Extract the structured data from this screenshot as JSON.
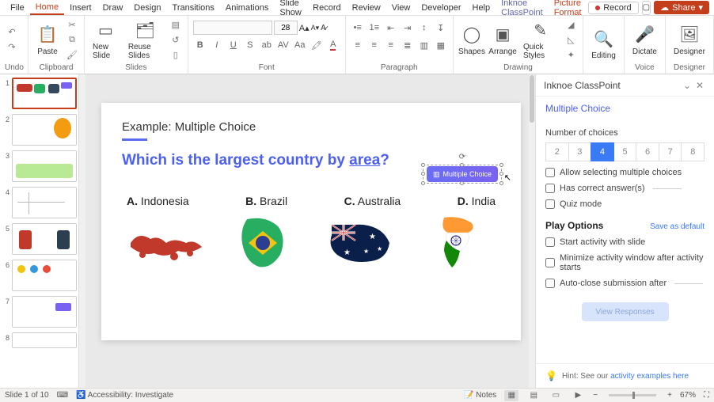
{
  "menubar": {
    "tabs": [
      "File",
      "Home",
      "Insert",
      "Draw",
      "Design",
      "Transitions",
      "Animations",
      "Slide Show",
      "Record",
      "Review",
      "View",
      "Developer",
      "Help"
    ],
    "addin": "Inknoe ClassPoint",
    "contextual": "Picture Format",
    "record": "Record",
    "share": "Share"
  },
  "ribbon": {
    "undo_label": "Undo",
    "paste": "Paste",
    "clipboard": "Clipboard",
    "new_slide": "New Slide",
    "reuse": "Reuse Slides",
    "slides": "Slides",
    "font_size": "28",
    "font": "",
    "font_group": "Font",
    "paragraph": "Paragraph",
    "shapes": "Shapes",
    "arrange": "Arrange",
    "quick": "Quick Styles",
    "drawing": "Drawing",
    "editing": "Editing",
    "dictate": "Dictate",
    "voice": "Voice",
    "designer": "Designer",
    "designer_group": "Designer"
  },
  "slide": {
    "label": "Example: Multiple Choice",
    "question_pre": "Which is the largest country by ",
    "question_u": "area",
    "question_post": "?",
    "opts": [
      {
        "letter": "A.",
        "text": "Indonesia"
      },
      {
        "letter": "B.",
        "text": "Brazil"
      },
      {
        "letter": "C.",
        "text": "Australia"
      },
      {
        "letter": "D.",
        "text": "India"
      }
    ],
    "cp_btn": "Multiple Choice"
  },
  "panel": {
    "title": "Inknoe ClassPoint",
    "subtitle": "Multiple Choice",
    "num_label": "Number of choices",
    "choices": [
      "2",
      "3",
      "4",
      "5",
      "6",
      "7",
      "8"
    ],
    "active_choice": "4",
    "allow": "Allow selecting multiple choices",
    "correct": "Has correct answer(s)",
    "quiz": "Quiz mode",
    "play": "Play Options",
    "save": "Save as default",
    "start": "Start activity with slide",
    "min": "Minimize activity window after activity starts",
    "auto": "Auto-close submission after",
    "view": "View Responses",
    "hint_pre": "Hint: See our ",
    "hint_link": "activity examples here"
  },
  "status": {
    "slide": "Slide 1 of 10",
    "access": "Accessibility: Investigate",
    "notes": "Notes",
    "zoom": "67%"
  },
  "thumbs": [
    1,
    2,
    3,
    4,
    5,
    6,
    7,
    8
  ]
}
